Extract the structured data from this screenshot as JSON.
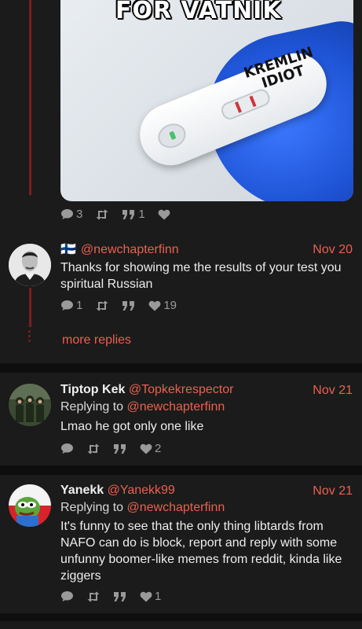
{
  "post0": {
    "image": {
      "caption": "FOR VATNIK",
      "label_line1": "KREMLIN",
      "label_line2": "IDIOT"
    },
    "actions": {
      "comments": "3",
      "retweets": "",
      "quotes": "1",
      "likes": ""
    }
  },
  "reply1": {
    "flag": "🇫🇮",
    "handle": "@newchapterfinn",
    "date": "Nov 20",
    "text": "Thanks for showing me the results of your test you spiritual Russian",
    "actions": {
      "comments": "1",
      "retweets": "",
      "quotes": "",
      "likes": "19"
    },
    "more_replies": "more replies"
  },
  "reply2": {
    "name": "Tiptop Kek",
    "handle": "@Topkekrespector",
    "date": "Nov 21",
    "replying_prefix": "Replying to",
    "replying_handle": "@newchapterfinn",
    "text": "Lmao he got only one like",
    "actions": {
      "comments": "",
      "retweets": "",
      "quotes": "",
      "likes": "2"
    }
  },
  "reply3": {
    "name": "Yanekk",
    "handle": "@Yanekk99",
    "date": "Nov 21",
    "replying_prefix": "Replying to",
    "replying_handle": "@newchapterfinn",
    "text": "It's funny to see that the only thing libtards from NAFO can do is block, report and reply with some unfunny boomer-like memes from reddit, kinda like ziggers",
    "actions": {
      "comments": "",
      "retweets": "",
      "quotes": "",
      "likes": "1"
    }
  },
  "colors": {
    "accent": "#e9614f",
    "thread_line": "#7a1f1f",
    "background": "#121212",
    "card": "#1b1b1b"
  },
  "icons": [
    "comment-icon",
    "retweet-icon",
    "quote-icon",
    "heart-icon",
    "avatar"
  ]
}
